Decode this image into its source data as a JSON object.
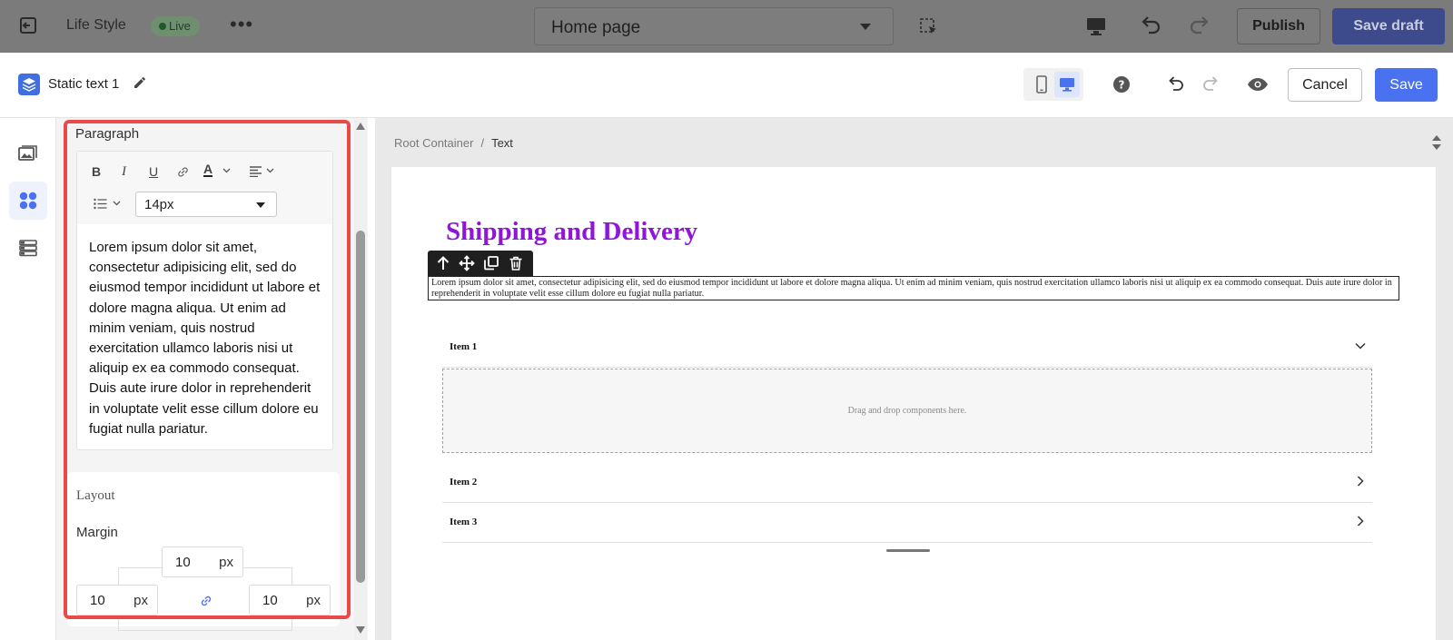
{
  "topbar": {
    "site_name": "Life Style",
    "live_badge": "Live",
    "page_select": "Home page",
    "publish_label": "Publish",
    "save_draft_label": "Save draft"
  },
  "modal": {
    "element_title": "Static text 1",
    "cancel_label": "Cancel",
    "save_label": "Save",
    "active_device": "desktop"
  },
  "settings": {
    "paragraph_label": "Paragraph",
    "font_size": "14px",
    "content": "Lorem ipsum dolor sit amet, consectetur adipisicing elit, sed do eiusmod tempor incididunt ut labore et dolore magna aliqua. Ut enim ad minim veniam, quis nostrud exercitation ullamco laboris nisi ut aliquip ex ea commodo consequat. Duis aute irure dolor in reprehenderit in voluptate velit esse cillum dolore eu fugiat nulla pariatur.",
    "layout_label": "Layout",
    "margin_label": "Margin",
    "margin": {
      "top": "10",
      "left": "10",
      "right": "10",
      "unit": "px"
    }
  },
  "canvas": {
    "breadcrumb": {
      "root": "Root Container",
      "separator": "/",
      "current": "Text"
    },
    "heading": "Shipping and Delivery",
    "paragraph": "Lorem ipsum dolor sit amet, consectetur adipisicing elit, sed do eiusmod tempor incididunt ut labore et dolore magna aliqua. Ut enim ad minim veniam, quis nostrud exercitation ullamco laboris nisi ut aliquip ex ea commodo consequat. Duis aute irure dolor in reprehenderit in voluptate velit esse cillum dolore eu fugiat nulla pariatur.",
    "accordion": [
      {
        "label": "Item 1",
        "state": "expanded"
      },
      {
        "label": "Item 2",
        "state": "collapsed"
      },
      {
        "label": "Item 3",
        "state": "collapsed"
      }
    ],
    "dropzone_text": "Drag and drop components here."
  },
  "colors": {
    "accent": "#4a72f0",
    "heading": "#8f16d6",
    "highlight": "#e84a4a",
    "live_dot": "#1a5a2a"
  }
}
